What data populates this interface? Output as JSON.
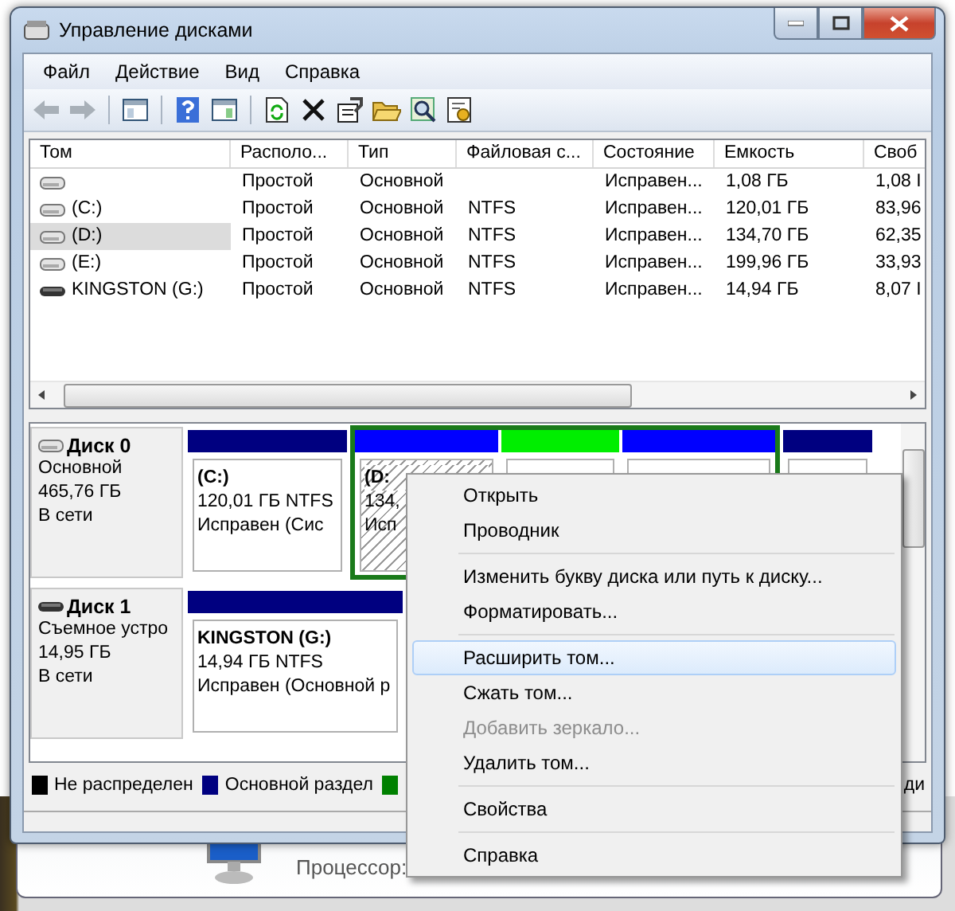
{
  "window": {
    "title": "Управление дисками"
  },
  "menu": [
    {
      "label": "Файл"
    },
    {
      "label": "Действие"
    },
    {
      "label": "Вид"
    },
    {
      "label": "Справка"
    }
  ],
  "toolbar": [
    {
      "kind": "back",
      "disabled": true
    },
    {
      "kind": "forward",
      "disabled": true
    },
    {
      "kind": "sep"
    },
    {
      "kind": "panel"
    },
    {
      "kind": "sep"
    },
    {
      "kind": "help"
    },
    {
      "kind": "panel2"
    },
    {
      "kind": "sep"
    },
    {
      "kind": "refresh"
    },
    {
      "kind": "delete"
    },
    {
      "kind": "properties"
    },
    {
      "kind": "open"
    },
    {
      "kind": "search"
    },
    {
      "kind": "settings"
    }
  ],
  "table": {
    "columns": [
      "Том",
      "Располо...",
      "Тип",
      "Файловая с...",
      "Состояние",
      "Емкость",
      "Своб"
    ],
    "rows": [
      {
        "kind": "hdd",
        "selected": false,
        "cells": [
          "",
          "Простой",
          "Основной",
          "",
          "Исправен...",
          "1,08 ГБ",
          "1,08 I"
        ]
      },
      {
        "kind": "hdd",
        "selected": false,
        "cells": [
          "(C:)",
          "Простой",
          "Основной",
          "NTFS",
          "Исправен...",
          "120,01 ГБ",
          "83,96"
        ]
      },
      {
        "kind": "hdd",
        "selected": true,
        "cells": [
          "(D:)",
          "Простой",
          "Основной",
          "NTFS",
          "Исправен...",
          "134,70 ГБ",
          "62,35"
        ]
      },
      {
        "kind": "hdd",
        "selected": false,
        "cells": [
          "(E:)",
          "Простой",
          "Основной",
          "NTFS",
          "Исправен...",
          "199,96 ГБ",
          "33,93"
        ]
      },
      {
        "kind": "usb",
        "selected": false,
        "cells": [
          "KINGSTON (G:)",
          "Простой",
          "Основной",
          "NTFS",
          "Исправен...",
          "14,94 ГБ",
          "8,07 I"
        ]
      }
    ]
  },
  "disks": [
    {
      "kind": "hdd",
      "name": "Диск 0",
      "lines": [
        "Основной",
        "465,76 ГБ",
        "В сети"
      ],
      "partitions": [
        {
          "color": "#000080",
          "extended": false,
          "selected": false,
          "title": "(C:)",
          "lines": [
            "120,01 ГБ NTFS",
            "Исправен (Сис"
          ]
        },
        {
          "color": "#0000ff",
          "extended": true,
          "selected": true,
          "title": "(D:",
          "lines": [
            "134,",
            "Исп"
          ]
        },
        {
          "color": "#00ee00",
          "extended": true,
          "selected": false
        },
        {
          "color": "#0000ff",
          "extended": true,
          "selected": false
        },
        {
          "color": "#000080",
          "extended": false,
          "selected": false
        }
      ]
    },
    {
      "kind": "usb",
      "name": "Диск 1",
      "lines": [
        "Съемное устро",
        "14,95 ГБ",
        "В сети"
      ],
      "partitions": [
        {
          "color": "#000080",
          "extended": false,
          "selected": false,
          "title": "KINGSTON  (G:)",
          "lines": [
            "14,94 ГБ NTFS",
            "Исправен (Основной р"
          ]
        }
      ]
    }
  ],
  "legend": [
    {
      "color": "#000000",
      "label": "Не распределен"
    },
    {
      "color": "#000080",
      "label": "Основной раздел"
    },
    {
      "color": "#008000"
    }
  ],
  "legend_tail": "ди",
  "context_menu": [
    {
      "label": "Открыть",
      "selected": false,
      "disabled": false,
      "separator_after": false
    },
    {
      "label": "Проводник",
      "selected": false,
      "disabled": false,
      "separator_after": true
    },
    {
      "label": "Изменить букву диска или путь к диску...",
      "selected": false,
      "disabled": false,
      "separator_after": false
    },
    {
      "label": "Форматировать...",
      "selected": false,
      "disabled": false,
      "separator_after": true
    },
    {
      "label": "Расширить том...",
      "selected": true,
      "disabled": false,
      "separator_after": false
    },
    {
      "label": "Сжать том...",
      "selected": false,
      "disabled": false,
      "separator_after": false
    },
    {
      "label": "Добавить зеркало...",
      "selected": false,
      "disabled": true,
      "separator_after": false
    },
    {
      "label": "Удалить том...",
      "selected": false,
      "disabled": false,
      "separator_after": true
    },
    {
      "label": "Свойства",
      "selected": false,
      "disabled": false,
      "separator_after": true
    },
    {
      "label": "Справка",
      "selected": false,
      "disabled": false,
      "separator_after": false
    }
  ],
  "background_window": {
    "label": "Процессор:"
  }
}
